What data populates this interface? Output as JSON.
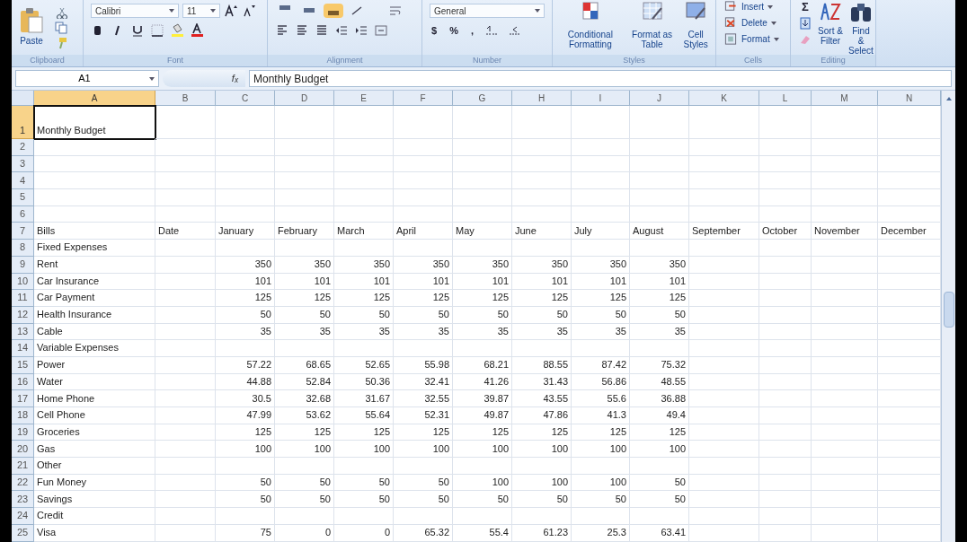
{
  "ribbon": {
    "groups": [
      {
        "label": "Clipboard",
        "buttons": [
          "Paste"
        ]
      },
      {
        "label": "Font",
        "font": "Calibri",
        "size": "11"
      },
      {
        "label": "Alignment"
      },
      {
        "label": "Number",
        "format": "General",
        "buttons": [
          "$",
          "%",
          ","
        ]
      },
      {
        "label": "Styles",
        "buttons": [
          "Conditional Formatting",
          "Format as Table",
          "Cell Styles"
        ]
      },
      {
        "label": "Cells",
        "buttons": [
          "Insert",
          "Delete",
          "Format"
        ]
      },
      {
        "label": "Editing",
        "buttons": [
          "Σ",
          "Sort & Filter",
          "Find & Select"
        ]
      }
    ]
  },
  "formula_bar": {
    "name_box": "A1",
    "fx": "f$_{x}$",
    "formula": "Monthly Budget"
  },
  "columns": [
    {
      "label": "A",
      "selected": true
    },
    {
      "label": "B",
      "selected": false
    },
    {
      "label": "C",
      "selected": false
    },
    {
      "label": "D",
      "selected": false
    },
    {
      "label": "E",
      "selected": false
    },
    {
      "label": "F",
      "selected": false
    },
    {
      "label": "G",
      "selected": false
    },
    {
      "label": "H",
      "selected": false
    },
    {
      "label": "I",
      "selected": false
    },
    {
      "label": "J",
      "selected": false
    },
    {
      "label": "K",
      "selected": false
    },
    {
      "label": "L",
      "selected": false
    },
    {
      "label": "M",
      "selected": false
    },
    {
      "label": "N",
      "selected": false
    }
  ],
  "rows": [
    {
      "number": "1",
      "kind": "title",
      "selected": true,
      "cells": {
        "A": "Monthly Budget"
      }
    },
    {
      "number": "2",
      "kind": "data",
      "selected": false,
      "cells": {}
    },
    {
      "number": "3",
      "kind": "data",
      "selected": false,
      "cells": {}
    },
    {
      "number": "4",
      "kind": "data",
      "selected": false,
      "cells": {}
    },
    {
      "number": "5",
      "kind": "data",
      "selected": false,
      "cells": {}
    },
    {
      "number": "6",
      "kind": "data",
      "selected": false,
      "cells": {}
    },
    {
      "number": "7",
      "kind": "header",
      "selected": false,
      "cells": {
        "A": "Bills",
        "B": "Date",
        "C": "January",
        "D": "February",
        "E": "March",
        "F": "April",
        "G": "May",
        "H": "June",
        "I": "July",
        "J": "August",
        "K": "September",
        "L": "October",
        "M": "November",
        "N": "December"
      }
    },
    {
      "number": "8",
      "kind": "data",
      "selected": false,
      "cells": {
        "A": "Fixed Expenses"
      }
    },
    {
      "number": "9",
      "kind": "data",
      "selected": false,
      "cells": {
        "A": "Rent",
        "C": "350",
        "D": "350",
        "E": "350",
        "F": "350",
        "G": "350",
        "H": "350",
        "I": "350",
        "J": "350"
      }
    },
    {
      "number": "10",
      "kind": "data",
      "selected": false,
      "cells": {
        "A": "Car Insurance",
        "C": "101",
        "D": "101",
        "E": "101",
        "F": "101",
        "G": "101",
        "H": "101",
        "I": "101",
        "J": "101"
      }
    },
    {
      "number": "11",
      "kind": "data",
      "selected": false,
      "cells": {
        "A": "Car Payment",
        "C": "125",
        "D": "125",
        "E": "125",
        "F": "125",
        "G": "125",
        "H": "125",
        "I": "125",
        "J": "125"
      }
    },
    {
      "number": "12",
      "kind": "data",
      "selected": false,
      "cells": {
        "A": "Health Insurance",
        "C": "50",
        "D": "50",
        "E": "50",
        "F": "50",
        "G": "50",
        "H": "50",
        "I": "50",
        "J": "50"
      }
    },
    {
      "number": "13",
      "kind": "data",
      "selected": false,
      "cells": {
        "A": "Cable",
        "C": "35",
        "D": "35",
        "E": "35",
        "F": "35",
        "G": "35",
        "H": "35",
        "I": "35",
        "J": "35"
      }
    },
    {
      "number": "14",
      "kind": "data",
      "selected": false,
      "cells": {
        "A": "Variable Expenses"
      }
    },
    {
      "number": "15",
      "kind": "data",
      "selected": false,
      "cells": {
        "A": "Power",
        "C": "57.22",
        "D": "68.65",
        "E": "52.65",
        "F": "55.98",
        "G": "68.21",
        "H": "88.55",
        "I": "87.42",
        "J": "75.32"
      }
    },
    {
      "number": "16",
      "kind": "data",
      "selected": false,
      "cells": {
        "A": "Water",
        "C": "44.88",
        "D": "52.84",
        "E": "50.36",
        "F": "32.41",
        "G": "41.26",
        "H": "31.43",
        "I": "56.86",
        "J": "48.55"
      }
    },
    {
      "number": "17",
      "kind": "data",
      "selected": false,
      "cells": {
        "A": "Home Phone",
        "C": "30.5",
        "D": "32.68",
        "E": "31.67",
        "F": "32.55",
        "G": "39.87",
        "H": "43.55",
        "I": "55.6",
        "J": "36.88"
      }
    },
    {
      "number": "18",
      "kind": "data",
      "selected": false,
      "cells": {
        "A": "Cell Phone",
        "C": "47.99",
        "D": "53.62",
        "E": "55.64",
        "F": "52.31",
        "G": "49.87",
        "H": "47.86",
        "I": "41.3",
        "J": "49.4"
      }
    },
    {
      "number": "19",
      "kind": "data",
      "selected": false,
      "cells": {
        "A": "Groceries",
        "C": "125",
        "D": "125",
        "E": "125",
        "F": "125",
        "G": "125",
        "H": "125",
        "I": "125",
        "J": "125"
      }
    },
    {
      "number": "20",
      "kind": "data",
      "selected": false,
      "cells": {
        "A": "Gas",
        "C": "100",
        "D": "100",
        "E": "100",
        "F": "100",
        "G": "100",
        "H": "100",
        "I": "100",
        "J": "100"
      }
    },
    {
      "number": "21",
      "kind": "data",
      "selected": false,
      "cells": {
        "A": "Other"
      }
    },
    {
      "number": "22",
      "kind": "data",
      "selected": false,
      "cells": {
        "A": "Fun Money",
        "C": "50",
        "D": "50",
        "E": "50",
        "F": "50",
        "G": "100",
        "H": "100",
        "I": "100",
        "J": "50"
      }
    },
    {
      "number": "23",
      "kind": "data",
      "selected": false,
      "cells": {
        "A": "Savings",
        "C": "50",
        "D": "50",
        "E": "50",
        "F": "50",
        "G": "50",
        "H": "50",
        "I": "50",
        "J": "50"
      }
    },
    {
      "number": "24",
      "kind": "data",
      "selected": false,
      "cells": {
        "A": "Credit"
      }
    },
    {
      "number": "25",
      "kind": "data",
      "selected": false,
      "cells": {
        "A": "Visa",
        "C": "75",
        "D": "0",
        "E": "0",
        "F": "65.32",
        "G": "55.4",
        "H": "61.23",
        "I": "25.3",
        "J": "63.41"
      }
    }
  ]
}
